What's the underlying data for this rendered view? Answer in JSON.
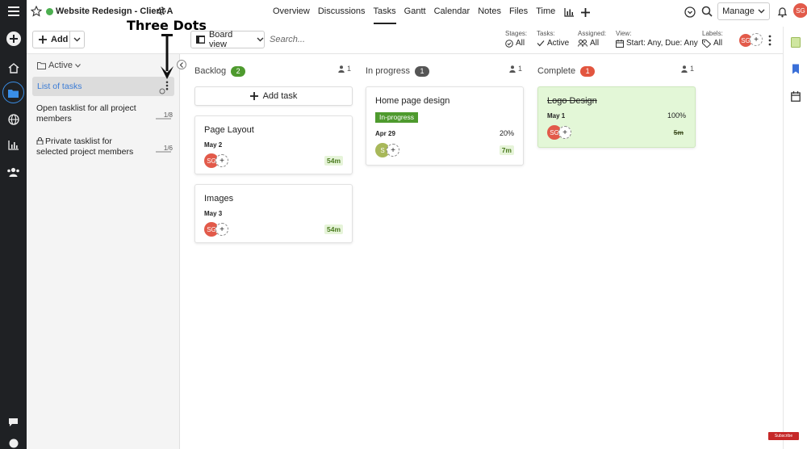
{
  "project": {
    "title": "Website Redesign - Client A",
    "status_color": "#4caf50"
  },
  "nav": {
    "tabs": [
      {
        "label": "Overview",
        "active": false
      },
      {
        "label": "Discussions",
        "active": false
      },
      {
        "label": "Tasks",
        "active": true
      },
      {
        "label": "Gantt",
        "active": false
      },
      {
        "label": "Calendar",
        "active": false
      },
      {
        "label": "Notes",
        "active": false
      },
      {
        "label": "Files",
        "active": false
      },
      {
        "label": "Time",
        "active": false
      }
    ],
    "manage_label": "Manage",
    "user_initials": "SG"
  },
  "toolbar": {
    "add_label": "Add",
    "view_label": "Board view",
    "search_placeholder": "Search...",
    "filters": [
      {
        "label": "Stages:",
        "value": "All",
        "icon": "check-circle-icon"
      },
      {
        "label": "Tasks:",
        "value": "Active",
        "icon": "check-icon"
      },
      {
        "label": "Assigned:",
        "value": "All",
        "icon": "people-icon"
      },
      {
        "label": "View:",
        "value": "Start: Any, Due: Any",
        "icon": "calendar-icon"
      },
      {
        "label": "Labels:",
        "value": "All",
        "icon": "tag-icon"
      }
    ],
    "member_initials": "SG"
  },
  "tasklists": {
    "filter_label": "Active",
    "items": [
      {
        "title": "List of tasks",
        "progress": "",
        "private": false,
        "selected": true
      },
      {
        "title": "Open tasklist for all project members",
        "progress": "1/8",
        "private": false,
        "selected": false
      },
      {
        "title": "Private tasklist for selected project members",
        "progress": "1/6",
        "private": true,
        "selected": false
      }
    ]
  },
  "annotation": {
    "text": "Three Dots"
  },
  "board": {
    "add_task_label": "Add task",
    "columns": [
      {
        "name": "Backlog",
        "count": "2",
        "badge_color": "#4e9a2e",
        "members": "1",
        "cards": [
          {
            "title": "Page Layout",
            "date": "May 2",
            "assignee": "SG",
            "time": "54m",
            "percent": "",
            "status": "",
            "done": false
          },
          {
            "title": "Images",
            "date": "May 3",
            "assignee": "SG",
            "time": "54m",
            "percent": "",
            "status": "",
            "done": false
          }
        ]
      },
      {
        "name": "In progress",
        "count": "1",
        "badge_color": "#555555",
        "members": "1",
        "cards": [
          {
            "title": "Home page design",
            "date": "Apr 29",
            "assignee": "S",
            "time": "7m",
            "percent": "20%",
            "status": "In-progress",
            "done": false
          }
        ]
      },
      {
        "name": "Complete",
        "count": "1",
        "badge_color": "#e2553f",
        "members": "1",
        "cards": [
          {
            "title": "Logo Design",
            "date": "May 1",
            "assignee": "SG",
            "time": "5m",
            "percent": "100%",
            "status": "",
            "done": true
          }
        ]
      }
    ]
  },
  "footer": {
    "subscribe_label": "Subscribe"
  }
}
